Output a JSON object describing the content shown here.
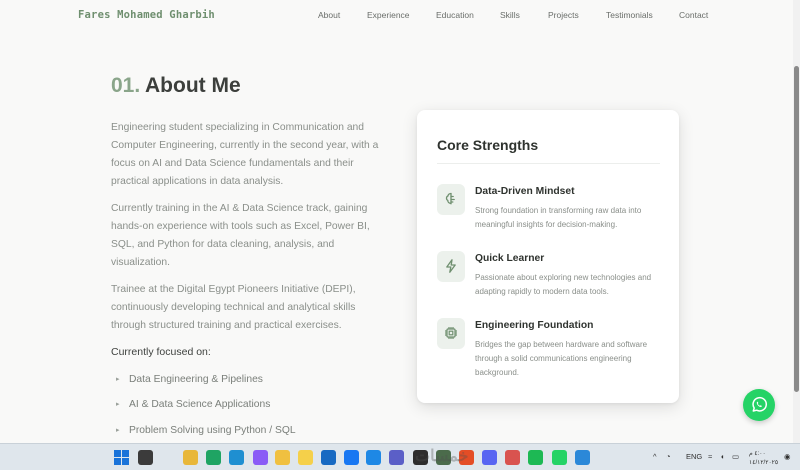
{
  "nav": {
    "brand": "Fares Mohamed Gharbih",
    "links": [
      {
        "label": "About"
      },
      {
        "label": "Experience"
      },
      {
        "label": "Education"
      },
      {
        "label": "Skills"
      },
      {
        "label": "Projects"
      },
      {
        "label": "Testimonials"
      },
      {
        "label": "Contact"
      }
    ]
  },
  "about": {
    "number": "01.",
    "title": "About Me",
    "paragraphs": [
      "Engineering student specializing in Communication and Computer Engineering, currently in the second year, with a focus on AI and Data Science fundamentals and their practical applications in data analysis.",
      "Currently training in the AI & Data Science track, gaining hands-on experience with tools such as Excel, Power BI, SQL, and Python for data cleaning, analysis, and visualization.",
      "Trainee at the Digital Egypt Pioneers Initiative (DEPI), continuously developing technical and analytical skills through structured training and practical exercises."
    ],
    "focus_title": "Currently focused on:",
    "focus_arrow": "▸",
    "focus_items": [
      "Data Engineering & Pipelines",
      "AI & Data Science Applications",
      "Problem Solving using Python / SQL"
    ]
  },
  "strengths": {
    "title": "Core Strengths",
    "items": [
      {
        "icon": "brain-icon",
        "title": "Data-Driven Mindset",
        "desc": "Strong foundation in transforming raw data into meaningful insights for decision-making."
      },
      {
        "icon": "lightning-icon",
        "title": "Quick Learner",
        "desc": "Passionate about exploring new technologies and adapting rapidly to modern data tools."
      },
      {
        "icon": "chip-icon",
        "title": "Engineering Foundation",
        "desc": "Bridges the gap between hardware and software through a solid communications engineering background."
      }
    ]
  },
  "whatsapp": {
    "icon": "whatsapp-icon"
  },
  "taskbar": {
    "watermark": "خمسات",
    "language": "ENG",
    "time": "٤:٠٠ م",
    "date": "١٤/١٢/٢٠٢٥",
    "apps": [
      {
        "name": "search-icon",
        "color": "#3b3b3b"
      },
      {
        "name": "file-explorer-icon",
        "color": "#e8b73a"
      },
      {
        "name": "google-drive-icon",
        "color": "#1fa463"
      },
      {
        "name": "edge-icon",
        "color": "#1f8fd1"
      },
      {
        "name": "copilot-icon",
        "color": "#8a5cf6"
      },
      {
        "name": "folder-icon",
        "color": "#f0c040"
      },
      {
        "name": "notes-icon",
        "color": "#f5d04a"
      },
      {
        "name": "mail-icon",
        "color": "#1769c2"
      },
      {
        "name": "facebook-icon",
        "color": "#1877f2"
      },
      {
        "name": "vscode-icon",
        "color": "#1e88e5"
      },
      {
        "name": "teams-icon",
        "color": "#5b5fc7"
      },
      {
        "name": "terminal-icon",
        "color": "#2d2d2d"
      },
      {
        "name": "app-icon",
        "color": "#4b6b4b"
      },
      {
        "name": "chrome-icon",
        "color": "#e44d26"
      },
      {
        "name": "discord-icon",
        "color": "#5865f2"
      },
      {
        "name": "office-icon",
        "color": "#d9534f"
      },
      {
        "name": "spotify-icon",
        "color": "#1db954"
      },
      {
        "name": "whatsapp-app-icon",
        "color": "#25d366"
      },
      {
        "name": "paint-icon",
        "color": "#2b88d8"
      }
    ]
  }
}
